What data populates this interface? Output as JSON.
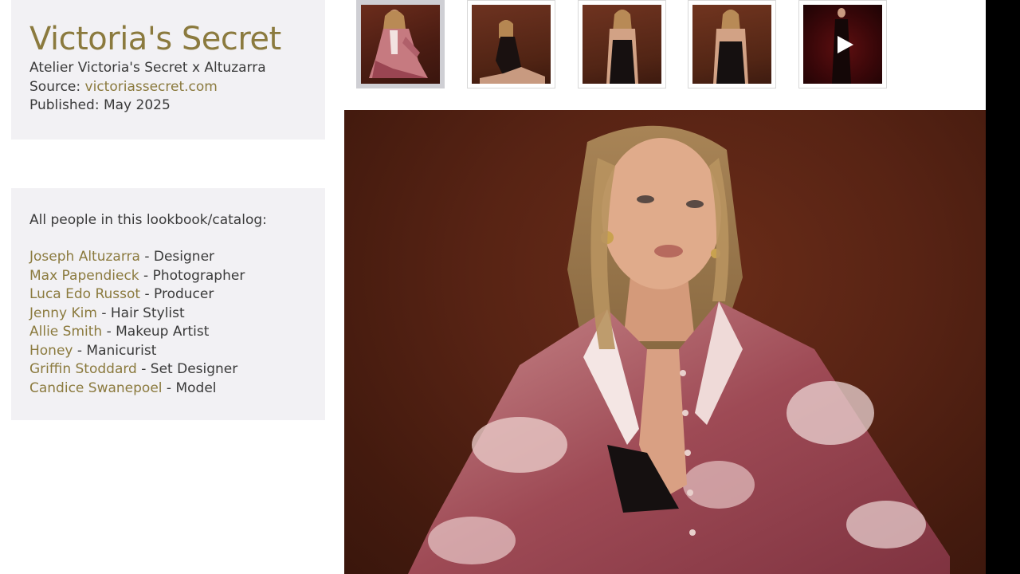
{
  "info": {
    "title": "Victoria's Secret",
    "subtitle": "Atelier Victoria's Secret x Altuzarra",
    "source_label": "Source:",
    "source_link": "victoriassecret.com",
    "published": "Published: May 2025"
  },
  "people": {
    "heading": "All people in this lookbook/catalog:",
    "list": [
      {
        "name": "Joseph Altuzarra",
        "role": " - Designer"
      },
      {
        "name": "Max Papendieck",
        "role": " - Photographer"
      },
      {
        "name": "Luca Edo Russot",
        "role": " - Producer"
      },
      {
        "name": "Jenny Kim",
        "role": " - Hair Stylist"
      },
      {
        "name": "Allie Smith",
        "role": " - Makeup Artist"
      },
      {
        "name": "Honey",
        "role": " - Manicurist"
      },
      {
        "name": "Griffin Stoddard",
        "role": " - Set Designer"
      },
      {
        "name": "Candice Swanepoel",
        "role": " - Model"
      }
    ]
  },
  "thumbnails": [
    {
      "type": "image",
      "active": true
    },
    {
      "type": "image",
      "active": false
    },
    {
      "type": "image",
      "active": false
    },
    {
      "type": "image",
      "active": false
    },
    {
      "type": "video",
      "active": false,
      "icon": "play-icon"
    }
  ],
  "colors": {
    "accent": "#8b7a3e",
    "card_bg": "#f2f1f4",
    "text": "#3a3a3a"
  }
}
